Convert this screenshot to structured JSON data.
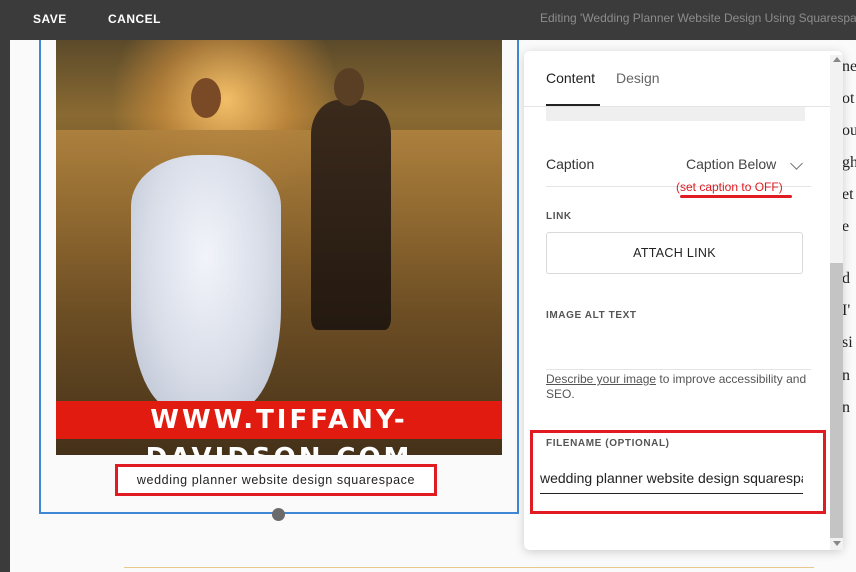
{
  "topbar": {
    "save_label": "SAVE",
    "cancel_label": "CANCEL",
    "editing_title": "Editing 'Wedding Planner Website Design Using Squarespace"
  },
  "image_block": {
    "banner_text": "WWW.TIFFANY-DAVIDSON.COM",
    "caption_text": "wedding planner website design squarespace"
  },
  "article_fragments": [
    "ne",
    "ot",
    "ou",
    "gh",
    "et",
    "e",
    "d",
    "I'",
    "si",
    "n",
    "n"
  ],
  "panel": {
    "tabs": [
      {
        "label": "Content",
        "active": true
      },
      {
        "label": "Design",
        "active": false
      }
    ],
    "caption_label": "Caption",
    "caption_value": "Caption Below",
    "annotation": "(set caption to OFF)",
    "link_label": "LINK",
    "attach_link_label": "ATTACH LINK",
    "alt_text_label": "IMAGE ALT TEXT",
    "alt_help_link": "Describe your image",
    "alt_help_rest": " to improve accessibility and SEO.",
    "filename_label": "FILENAME (OPTIONAL)",
    "filename_value": "wedding planner website design squarespace"
  },
  "colors": {
    "topbar": "#3b3b3b",
    "selection_border": "#3f88d6",
    "highlight_red": "#e01b22",
    "banner_red": "#e11b10"
  }
}
